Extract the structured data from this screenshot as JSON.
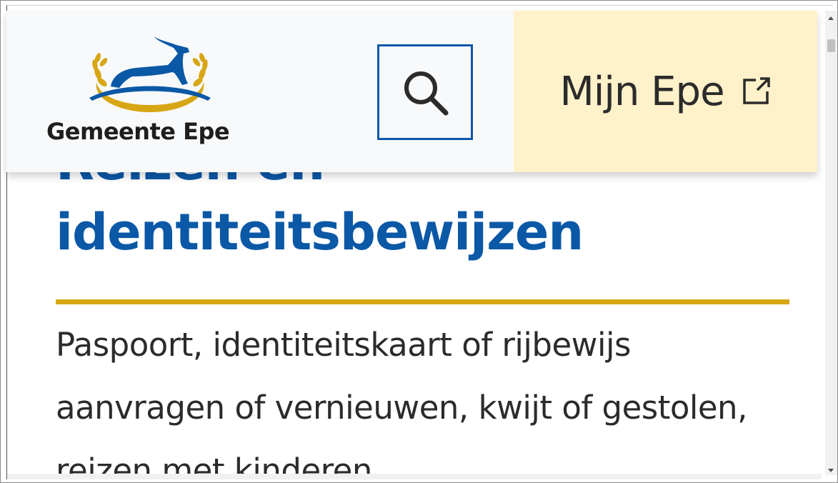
{
  "header": {
    "logo_text": "Gemeente Epe",
    "mijn_epe_label": "Mijn Epe",
    "colors": {
      "brand_blue": "#0b58a6",
      "gold": "#d7a615",
      "mijn_bg": "#fff1c9",
      "header_bg": "#f8f9fa"
    },
    "icons": {
      "search": "search-icon",
      "external": "external-link-icon",
      "logo": "gemeente-epe-deer-logo"
    }
  },
  "main": {
    "title_line1": "Reizen en",
    "title_line2": "identiteitsbewijzen",
    "intro_line1": "Paspoort, identiteitskaart of rijbewijs",
    "intro_line2": "aanvragen of vernieuwen, kwijt of gestolen,",
    "intro_line3": "reizen met kinderen"
  }
}
